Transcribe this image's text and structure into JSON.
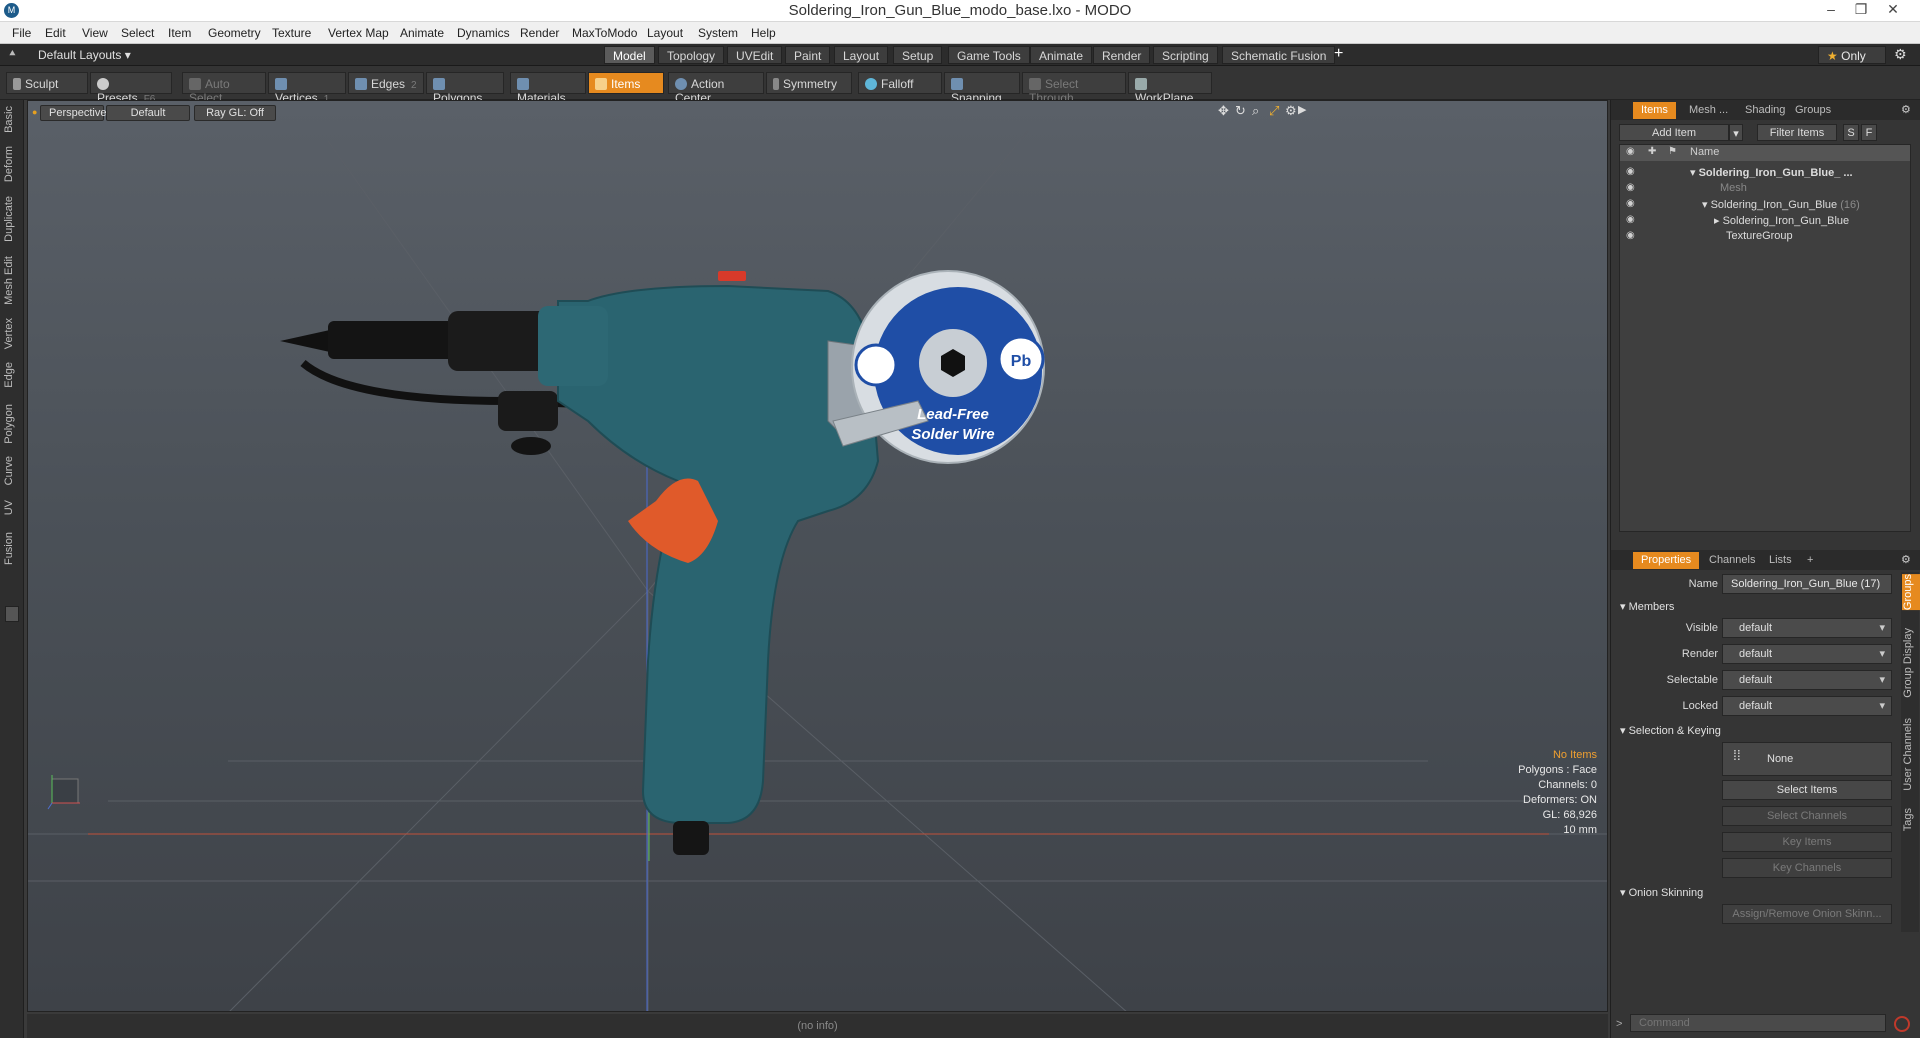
{
  "window": {
    "title": "Soldering_Iron_Gun_Blue_modo_base.lxo - MODO",
    "logo": "M"
  },
  "menu": [
    "File",
    "Edit",
    "View",
    "Select",
    "Item",
    "Geometry",
    "Texture",
    "Vertex Map",
    "Animate",
    "Dynamics",
    "Render",
    "MaxToModo",
    "Layout",
    "System",
    "Help"
  ],
  "layoutbar": {
    "layout_label": "Default Layouts",
    "tabs": [
      "Model",
      "Topology",
      "UVEdit",
      "Paint",
      "Layout",
      "Setup",
      "Game Tools",
      "Animate",
      "Render",
      "Scripting",
      "Schematic Fusion"
    ],
    "active_tab": "Model",
    "plus": "+",
    "only_label": "Only"
  },
  "toolbar": {
    "sculpt": "Sculpt",
    "presets": "Presets",
    "presets_key": "F6",
    "auto_select": "Auto Select",
    "vertices": "Vertices",
    "vertices_count": "1",
    "edges": "Edges",
    "edges_count": "2",
    "polygons": "Polygons",
    "materials": "Materials",
    "items": "Items",
    "action_center": "Action Center",
    "symmetry": "Symmetry",
    "falloff": "Falloff",
    "snapping": "Snapping",
    "select_through": "Select Through",
    "workplane": "WorkPlane"
  },
  "left_tabs": [
    "Basic",
    "Deform",
    "Duplicate",
    "Mesh Edit",
    "Vertex",
    "Edge",
    "Polygon",
    "Curve",
    "UV",
    "Fusion"
  ],
  "viewport": {
    "view_mode": "Perspective",
    "shading": "Default",
    "raygl": "Ray GL: Off",
    "info": {
      "no_items": "No Items",
      "polygons": "Polygons : Face",
      "channels": "Channels: 0",
      "deformers": "Deformers: ON",
      "gl": "GL: 68,926",
      "scale": "10 mm"
    },
    "reel_text_1": "Lead-Free",
    "reel_text_2": "Solder Wire",
    "reel_badge": "Pb"
  },
  "status": "(no info)",
  "items_panel": {
    "tabs": [
      "Items",
      "Mesh ...",
      "Shading",
      "Groups"
    ],
    "add_item": "Add Item",
    "filter_items": "Filter Items",
    "s_btn": "S",
    "f_btn": "F",
    "name_header": "Name",
    "tree": [
      {
        "label": "Soldering_Iron_Gun_Blue_ ..."
      },
      {
        "label": "Mesh"
      },
      {
        "label": "Soldering_Iron_Gun_Blue",
        "count": "(16)"
      },
      {
        "label": "Soldering_Iron_Gun_Blue"
      },
      {
        "label": "TextureGroup"
      }
    ]
  },
  "properties": {
    "tabs": [
      "Properties",
      "Channels",
      "Lists",
      "+"
    ],
    "name_label": "Name",
    "name_value": "Soldering_Iron_Gun_Blue (17)",
    "members": "Members",
    "visible_label": "Visible",
    "visible_value": "default",
    "render_label": "Render",
    "render_value": "default",
    "selectable_label": "Selectable",
    "selectable_value": "default",
    "locked_label": "Locked",
    "locked_value": "default",
    "selection_keying": "Selection & Keying",
    "none": "None",
    "select_items": "Select Items",
    "select_channels": "Select Channels",
    "key_items": "Key Items",
    "key_channels": "Key Channels",
    "onion_skinning": "Onion Skinning",
    "assign_onion": "Assign/Remove Onion Skinn...",
    "side_tabs": [
      "Groups",
      "Group Display",
      "User Channels",
      "Tags"
    ]
  },
  "command": {
    "placeholder": "Command"
  }
}
